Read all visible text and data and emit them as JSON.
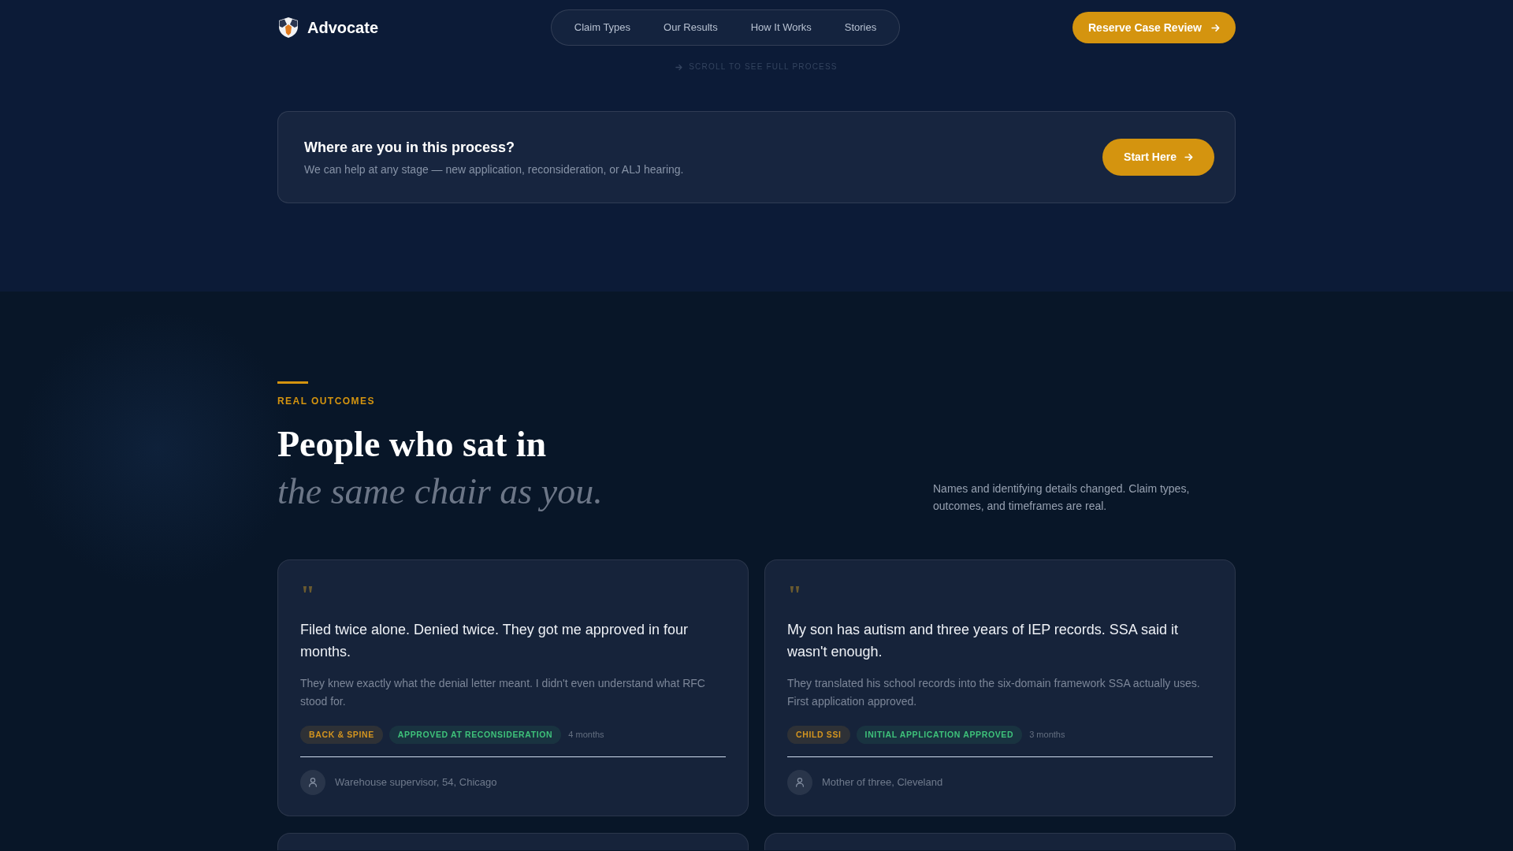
{
  "header": {
    "logo_text": "Advocate",
    "nav": [
      "Claim Types",
      "Our Results",
      "How It Works",
      "Stories"
    ],
    "cta": "Reserve Case Review"
  },
  "scroll_hint": "SCROLL TO SEE FULL PROCESS",
  "process_prompt": {
    "title": "Where are you in this process?",
    "text": "We can help at any stage — new application, reconsideration, or ALJ hearing.",
    "button": "Start Here"
  },
  "outcomes": {
    "eyebrow": "REAL OUTCOMES",
    "heading": "People who sat in",
    "heading_italic": "the same chair as you.",
    "note": "Names and identifying details changed. Claim types, outcomes, and timeframes are real.",
    "testimonials": [
      {
        "kind": "full",
        "quote_mark": "\"",
        "quote": "Filed twice alone. Denied twice. They got me approved in four months.",
        "detail": "They knew exactly what the denial letter meant. I didn't even understand what RFC stood for.",
        "claim_type": "BACK & SPINE",
        "outcome": "APPROVED AT RECONSIDERATION",
        "duration": "4 months",
        "author": "Warehouse supervisor, 54, Chicago"
      },
      {
        "kind": "full",
        "quote_mark": "\"",
        "quote": "My son has autism and three years of IEP records. SSA said it wasn't enough.",
        "detail": "They translated his school records into the six-domain framework SSA actually uses. First application approved.",
        "claim_type": "CHILD SSI",
        "outcome": "INITIAL APPLICATION APPROVED",
        "duration": "3 months",
        "author": "Mother of three, Cleveland"
      },
      {
        "kind": "cut"
      },
      {
        "kind": "cut"
      }
    ]
  }
}
